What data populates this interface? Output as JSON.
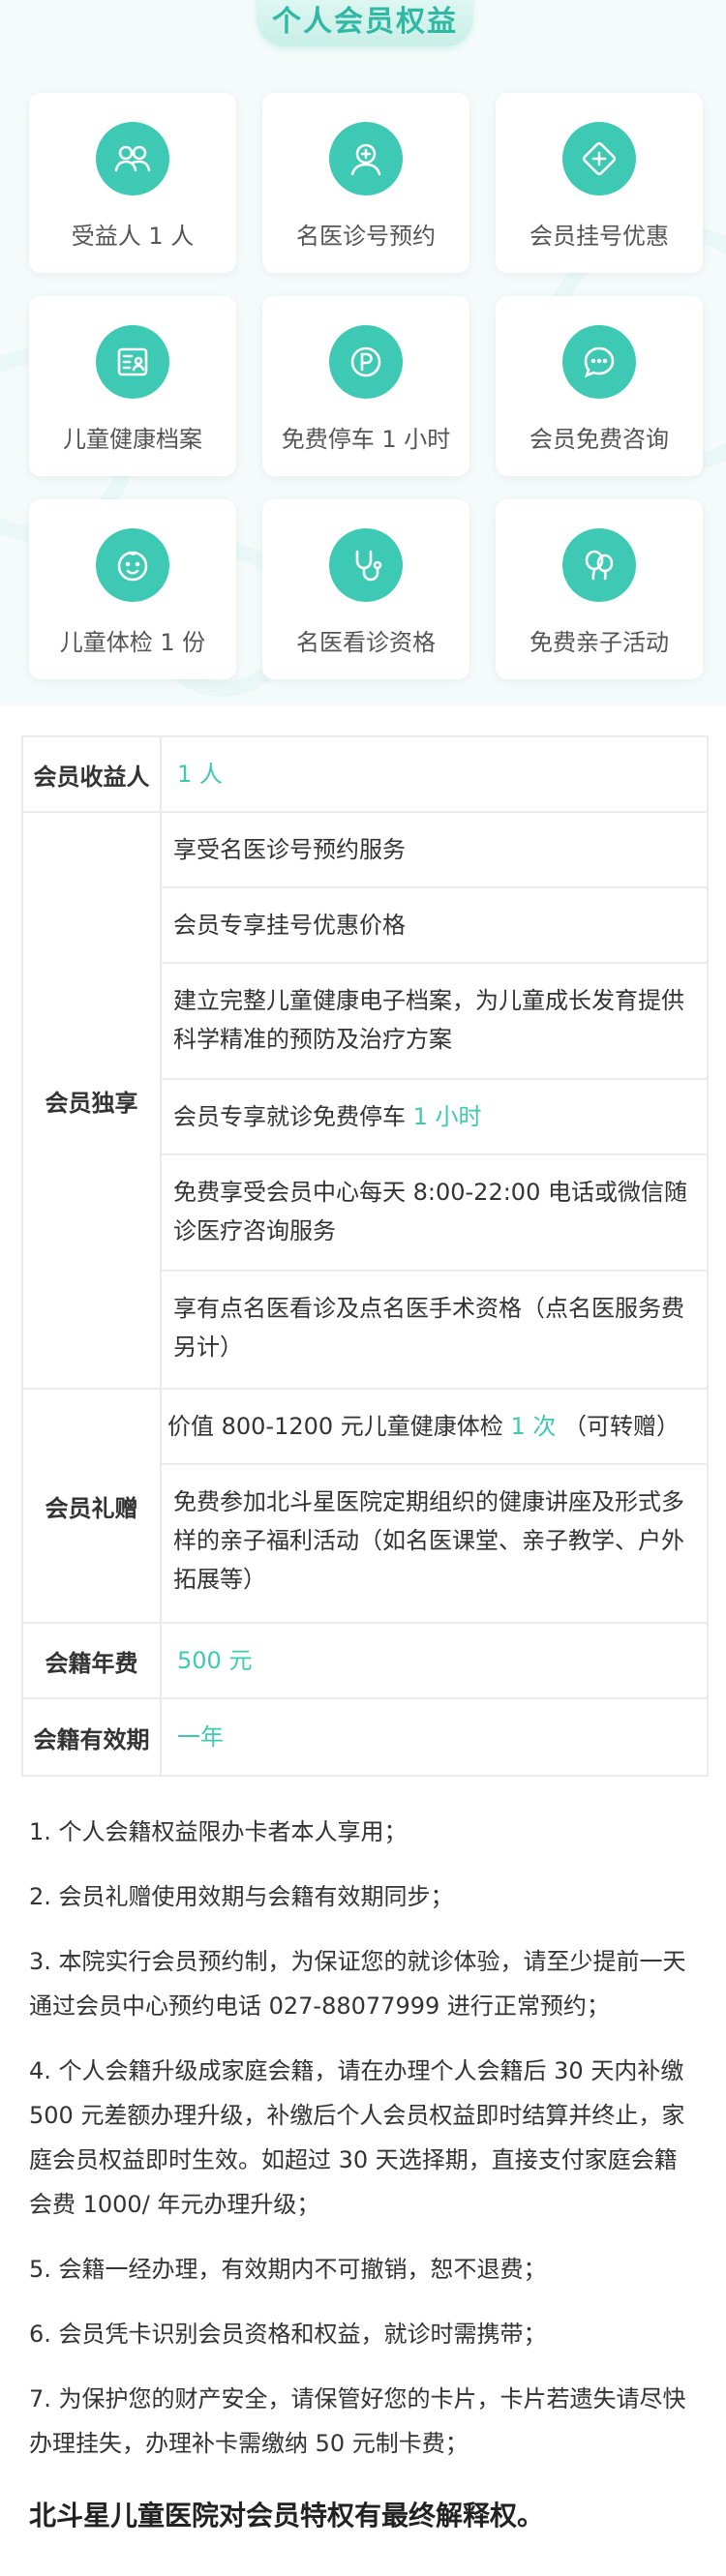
{
  "header": {
    "title": "个人会员权益"
  },
  "benefits": [
    {
      "label": "受益人 1 人",
      "icon": "people-icon"
    },
    {
      "label": "名医诊号预约",
      "icon": "doctor-icon"
    },
    {
      "label": "会员挂号优惠",
      "icon": "discount-icon"
    },
    {
      "label": "儿童健康档案",
      "icon": "health-record-icon"
    },
    {
      "label": "免费停车 1 小时",
      "icon": "parking-icon"
    },
    {
      "label": "会员免费咨询",
      "icon": "chat-icon"
    },
    {
      "label": "儿童体检 1 份",
      "icon": "baby-face-icon"
    },
    {
      "label": "名医看诊资格",
      "icon": "stethoscope-icon"
    },
    {
      "label": "免费亲子活动",
      "icon": "balloon-icon"
    }
  ],
  "table": {
    "beneficiary": {
      "head": "会员收益人",
      "value": "1 人"
    },
    "exclusive": {
      "head": "会员独享",
      "items": [
        {
          "text": "享受名医诊号预约服务"
        },
        {
          "text": "会员专享挂号优惠价格"
        },
        {
          "text": "建立完整儿童健康电子档案，为儿童成长发育提供科学精准的预防及治疗方案"
        },
        {
          "text": "会员专享就诊免费停车",
          "accent": "1 小时"
        },
        {
          "text": "免费享受会员中心每天 8:00-22:00 电话或微信随诊医疗咨询服务"
        },
        {
          "text": "享有点名医看诊及点名医手术资格（点名医服务费另计）"
        }
      ]
    },
    "gift": {
      "head": "会员礼赠",
      "items": [
        {
          "pre": "价值 800-1200 元儿童健康体检",
          "accent": "1 次",
          "post": "（可转赠）"
        },
        {
          "text": "免费参加北斗星医院定期组织的健康讲座及形式多样的亲子福利活动（如名医课堂、亲子教学、户外拓展等）"
        }
      ]
    },
    "fee": {
      "head": "会籍年费",
      "value": "500 元"
    },
    "validity": {
      "head": "会籍有效期",
      "value": "一年"
    }
  },
  "notes": [
    "1. 个人会籍权益限办卡者本人享用；",
    "2. 会员礼赠使用效期与会籍有效期同步；",
    "3. 本院实行会员预约制，为保证您的就诊体验，请至少提前一天通过会员中心预约电话 027-88077999 进行正常预约；",
    "4. 个人会籍升级成家庭会籍，请在办理个人会籍后 30 天内补缴 500 元差额办理升级，补缴后个人会员权益即时结算并终止，家庭会员权益即时生效。如超过 30 天选择期，直接支付家庭会籍会费 1000/ 年元办理升级；",
    "5. 会籍一经办理，有效期内不可撤销，恕不退费；",
    "6. 会员凭卡识别会员资格和权益，就诊时需携带；",
    "7. 为保护您的财产安全，请保管好您的卡片，卡片若遗失请尽快办理挂失，办理补卡需缴纳 50 元制卡费；"
  ],
  "footer": {
    "statement": "北斗星儿童医院对会员特权有最终解释权。"
  },
  "colors": {
    "accent": "#3ec9b4",
    "border": "#eaeaea"
  }
}
